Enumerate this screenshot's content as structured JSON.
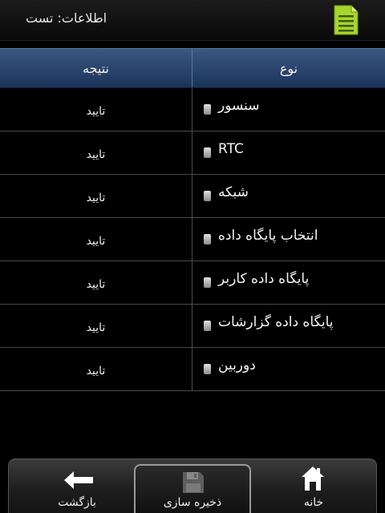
{
  "header": {
    "title": "اطلاعات: تست",
    "icon": "document-icon"
  },
  "table": {
    "columns": {
      "result": "نتیجه",
      "type": "نوع"
    },
    "rows": [
      {
        "type": "سنسور",
        "result": "تایید"
      },
      {
        "type": "RTC",
        "result": "تایید"
      },
      {
        "type": "شبکه",
        "result": "تایید"
      },
      {
        "type": "انتخاب پایگاه داده",
        "result": "تایید"
      },
      {
        "type": "پایگاه داده کاربر",
        "result": "تایید"
      },
      {
        "type": "پایگاه داده گزارشات",
        "result": "تایید"
      },
      {
        "type": "دوربین",
        "result": "تایید"
      }
    ]
  },
  "toolbar": {
    "back_label": "بازگشت",
    "save_label": "ذخیره سازی",
    "home_label": "خانه"
  },
  "colors": {
    "header_blue": "#2c4a70",
    "icon_green": "#9fd22a"
  }
}
